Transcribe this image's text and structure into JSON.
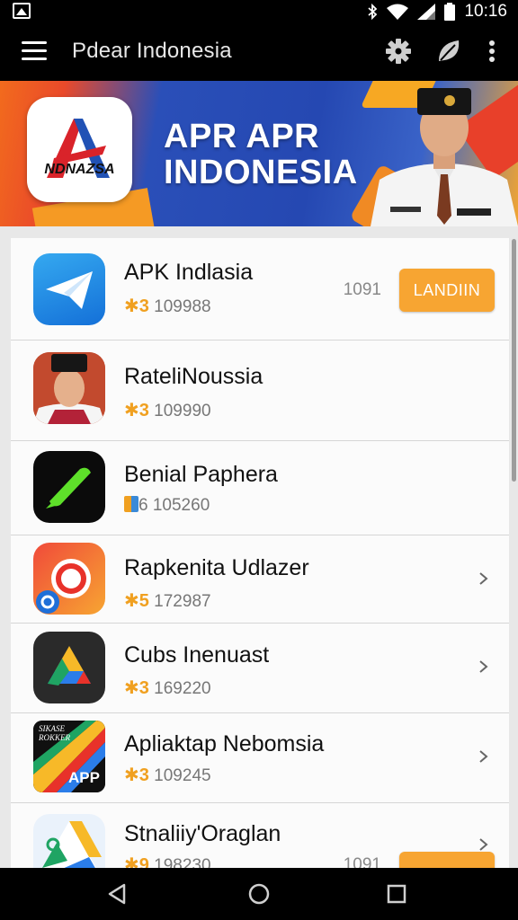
{
  "status_bar": {
    "time": "10:16",
    "icons": [
      "image-icon",
      "bluetooth-icon",
      "wifi-icon",
      "signal-icon",
      "battery-icon"
    ]
  },
  "toolbar": {
    "title": "Pdear Indonesia",
    "icons": [
      "hamburger-menu-icon",
      "gear-icon",
      "leaf-icon",
      "more-vert-icon"
    ]
  },
  "banner": {
    "logo_text": "NDNAZSA",
    "headline_line1": "APR APR",
    "headline_line2": "INDONESIA"
  },
  "apps": [
    {
      "name": "APK Indlasia",
      "star": "✱3",
      "downloads": "109988",
      "count": "1091",
      "button": "LANDIIN",
      "icon": "paper-plane-icon"
    },
    {
      "name": "RateliNoussia",
      "star": "✱3",
      "downloads": "109990",
      "icon": "portrait-icon"
    },
    {
      "name": "Benial Paphera",
      "star": "6",
      "downloads": "105260",
      "icon": "green-marker-icon"
    },
    {
      "name": "Rapkenita Udlazer",
      "star": "✱5",
      "downloads": "172987",
      "icon": "red-ring-icon"
    },
    {
      "name": "Cubs Inenuast",
      "star": "✱3",
      "downloads": "169220",
      "icon": "drive-triangle-icon"
    },
    {
      "name": "Apliaktap Nebomsia",
      "star": "✱3",
      "downloads": "109245",
      "icon": "app-stripes-icon",
      "icon_label": "APP",
      "icon_small_text": "SIKASE ROKKER"
    },
    {
      "name": "Stnaliiy'Oraglan",
      "star": "✱9",
      "downloads": "198230",
      "count": "1091",
      "icon": "drive-colorful-icon"
    }
  ],
  "colors": {
    "accent_orange": "#f7a532",
    "star_orange": "#f0a020",
    "banner_blue": "#2548b2"
  }
}
